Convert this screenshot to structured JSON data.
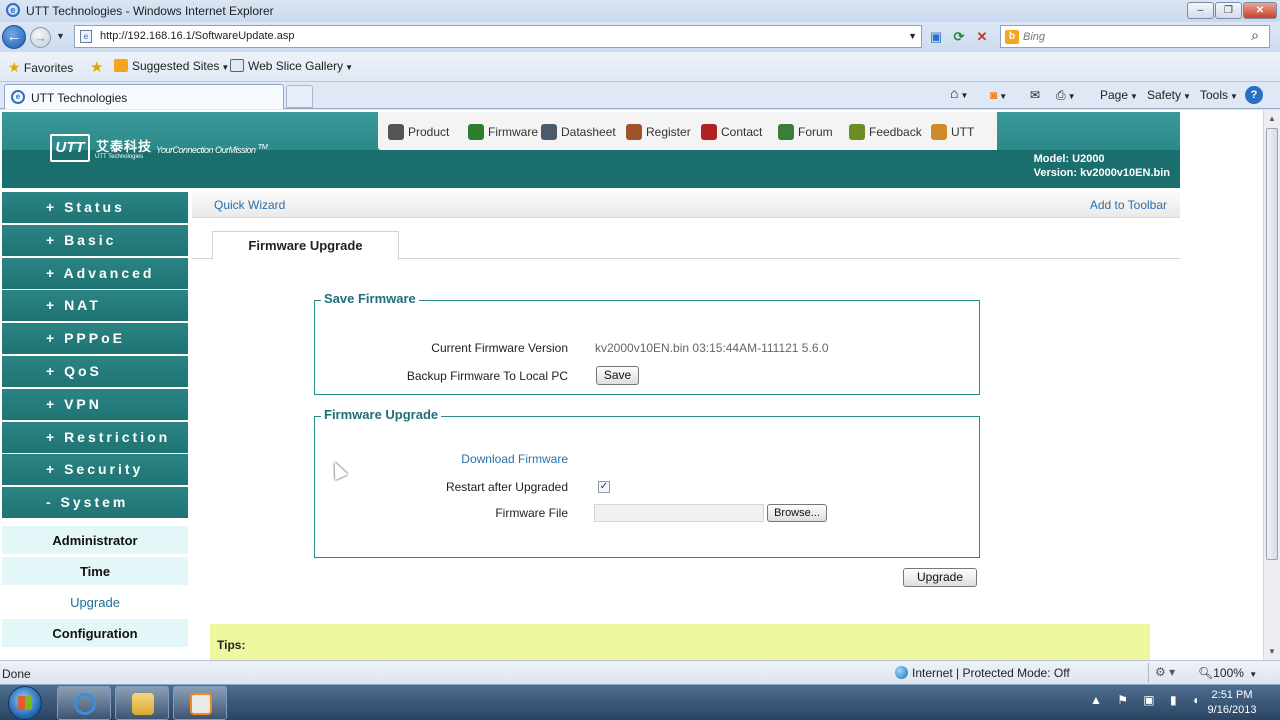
{
  "window": {
    "title": "UTT Technologies - Windows Internet Explorer",
    "min": "–",
    "max": "❐",
    "close": "✕"
  },
  "address": {
    "url": "http://192.168.16.1/SoftwareUpdate.asp",
    "search_placeholder": "Bing"
  },
  "favorites_bar": {
    "favorites": "Favorites",
    "suggested": "Suggested Sites",
    "webslice": "Web Slice Gallery"
  },
  "tab": {
    "label": "UTT Technologies"
  },
  "commandbar": {
    "page": "Page",
    "safety": "Safety",
    "tools": "Tools",
    "help": "?"
  },
  "utt": {
    "logo": "UTT",
    "company_cn": "艾泰科技",
    "company_en": "UTT Technologies",
    "slogan": "YourConnection OurMission",
    "tm": "TM",
    "model": "Model: U2000",
    "version": "Version: kv2000v10EN.bin"
  },
  "top_links": [
    {
      "label": "Product",
      "icon_color": "#555555"
    },
    {
      "label": "Firmware",
      "icon_color": "#2f7d2f"
    },
    {
      "label": "Datasheet",
      "icon_color": "#4a5a6a"
    },
    {
      "label": "Register",
      "icon_color": "#a0522d"
    },
    {
      "label": "Contact",
      "icon_color": "#b22222"
    },
    {
      "label": "Forum",
      "icon_color": "#3b7d3b"
    },
    {
      "label": "Feedback",
      "icon_color": "#6b8e23"
    },
    {
      "label": "UTT",
      "icon_color": "#d08a2a"
    }
  ],
  "sidebar": {
    "menu": [
      "+ Status",
      "+ Basic",
      "+ Advanced",
      "+ NAT",
      "+ PPPoE",
      "+ QoS",
      "+ VPN",
      "+ Restriction",
      "+ Security",
      "- System"
    ],
    "submenu": [
      "Administrator",
      "Time",
      "Upgrade",
      "Configuration"
    ],
    "active_submenu": "Upgrade"
  },
  "quickbar": {
    "wizard": "Quick Wizard",
    "add_toolbar": "Add to Toolbar"
  },
  "page_tab": "Firmware Upgrade",
  "save_section": {
    "legend": "Save Firmware",
    "current_version_label": "Current Firmware Version",
    "current_version_value": "kv2000v10EN.bin 03:15:44AM-111121 5.6.0",
    "backup_label": "Backup Firmware To Local PC",
    "save_button": "Save"
  },
  "upgrade_section": {
    "legend": "Firmware Upgrade",
    "download_link": "Download Firmware",
    "restart_label": "Restart after Upgraded",
    "restart_checked": true,
    "file_label": "Firmware File",
    "browse_button": "Browse..."
  },
  "upgrade_button": "Upgrade",
  "tips": "Tips:",
  "statusbar": {
    "status": "Done",
    "zone": "Internet | Protected Mode: Off",
    "zoom": "100%"
  },
  "taskbar": {
    "time": "2:51 PM",
    "date": "9/16/2013"
  }
}
